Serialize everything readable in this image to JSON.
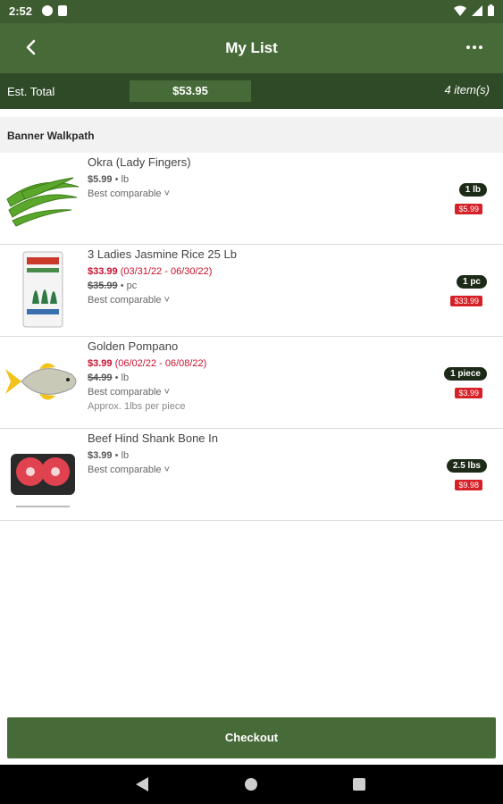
{
  "status_bar": {
    "time": "2:52"
  },
  "app_bar": {
    "title": "My List",
    "back_icon": "back-arrow-icon",
    "menu_icon": "more-dots-icon"
  },
  "summary": {
    "label": "Est. Total",
    "total": "$53.95",
    "item_count": "4 item(s)"
  },
  "section": {
    "title": "Banner Walkpath"
  },
  "items": [
    {
      "name": "Okra (Lady Fingers)",
      "regular_price": "$5.99",
      "unit": " • lb",
      "comparable": "Best comparable ˅",
      "qty": "1 lb",
      "line_total": "$5.99"
    },
    {
      "name": "3 Ladies Jasmine Rice 25 Lb",
      "sale_price": "$33.99",
      "sale_dates": " (03/31/22 - 06/30/22)",
      "orig_price": "$35.99",
      "unit": " • pc",
      "comparable": "Best comparable ˅",
      "qty": "1 pc",
      "line_total": "$33.99"
    },
    {
      "name": "Golden Pompano",
      "sale_price": "$3.99",
      "sale_dates": " (06/02/22 - 06/08/22)",
      "orig_price": "$4.99",
      "unit": " • lb",
      "comparable": "Best comparable ˅",
      "approx": "Approx. 1lbs per piece",
      "qty": "1 piece",
      "line_total": "$3.99"
    },
    {
      "name": "Beef Hind Shank Bone In",
      "regular_price": "$3.99",
      "unit": " • lb",
      "comparable": "Best comparable ˅",
      "qty": "2.5 lbs",
      "line_total": "$9.98"
    }
  ],
  "checkout": {
    "label": "Checkout"
  },
  "colors": {
    "header": "#476b38",
    "total_bar": "#2f4a27",
    "sale": "#c8102e",
    "badge": "#d61f26"
  }
}
